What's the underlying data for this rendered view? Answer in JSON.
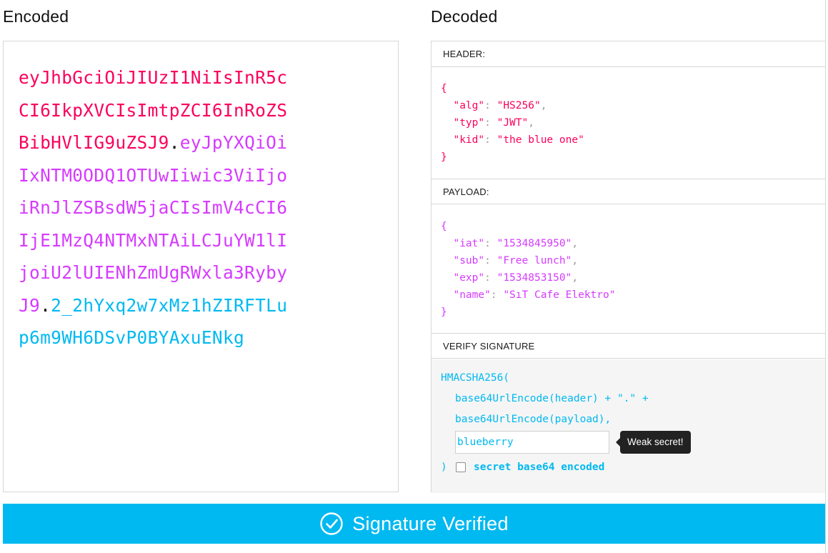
{
  "encoded": {
    "title": "Encoded",
    "lines": [
      [
        {
          "t": "eyJhbGciOiJIUzI1NiIsInR5c",
          "c": "h"
        }
      ],
      [
        {
          "t": "CI6IkpXVCIsImtpZCI6InRoZS",
          "c": "h"
        }
      ],
      [
        {
          "t": "BibHVlIG9uZSJ9",
          "c": "h"
        },
        {
          "t": ".",
          "c": "d"
        },
        {
          "t": "eyJpYXQiOi",
          "c": "p"
        }
      ],
      [
        {
          "t": "IxNTM0ODQ1OTUwIiwic3ViIjo",
          "c": "p"
        }
      ],
      [
        {
          "t": "iRnJlZSBsdW5jaCIsImV4cCI6",
          "c": "p"
        }
      ],
      [
        {
          "t": "IjE1MzQ4NTMxNTAiLCJuYW1lI",
          "c": "p"
        }
      ],
      [
        {
          "t": "joiU2lUIENhZmUgRWxla3Ryby",
          "c": "p"
        }
      ],
      [
        {
          "t": "J9",
          "c": "p"
        },
        {
          "t": ".",
          "c": "d"
        },
        {
          "t": "2_2hYxq2w7xMz1hZIRFTLu",
          "c": "s"
        }
      ],
      [
        {
          "t": "p6m9WH6DSvP0BYAxuENkg",
          "c": "s"
        }
      ]
    ]
  },
  "decoded": {
    "title": "Decoded",
    "header": {
      "label": "HEADER:",
      "open": "{",
      "close": "}",
      "fields": [
        {
          "key": "\"alg\"",
          "value": "\"HS256\"",
          "comma": ","
        },
        {
          "key": "\"typ\"",
          "value": "\"JWT\"",
          "comma": ","
        },
        {
          "key": "\"kid\"",
          "value": "\"the blue one\"",
          "comma": ""
        }
      ]
    },
    "payload": {
      "label": "PAYLOAD:",
      "open": "{",
      "close": "}",
      "fields": [
        {
          "key": "\"iat\"",
          "value": "\"1534845950\"",
          "comma": ","
        },
        {
          "key": "\"sub\"",
          "value": "\"Free lunch\"",
          "comma": ","
        },
        {
          "key": "\"exp\"",
          "value": "\"1534853150\"",
          "comma": ","
        },
        {
          "key": "\"name\"",
          "value": "\"SıT Cafe Elektro\"",
          "comma": ""
        }
      ]
    },
    "verify": {
      "label": "VERIFY SIGNATURE",
      "line1": "HMACSHA256(",
      "line2": "base64UrlEncode(header) + \".\" +",
      "line3": "base64UrlEncode(payload),",
      "secret_value": "blueberry",
      "tooltip": "Weak secret!",
      "close": ")",
      "checkbox_label": "secret base64 encoded",
      "checkbox_checked": false
    }
  },
  "status": {
    "text": "Signature Verified",
    "icon": "check-circle-icon",
    "color": "#00b9f1"
  },
  "colors": {
    "header": "#fb015b",
    "payload": "#d63aff",
    "signature": "#00b9f1"
  }
}
